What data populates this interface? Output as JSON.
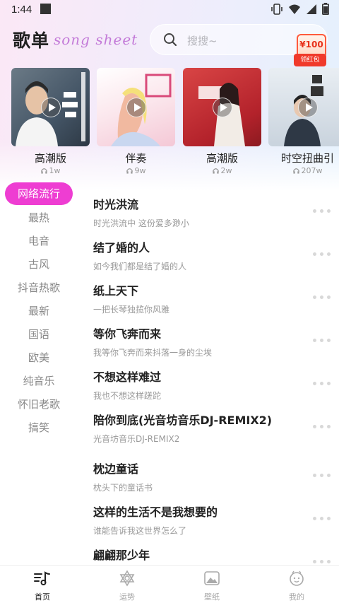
{
  "status_bar": {
    "time": "1:44"
  },
  "header": {
    "title": "歌单",
    "subtitle": "song sheet",
    "search_placeholder": "搜搜~",
    "red_packet": {
      "amount": "¥100",
      "label": "领红包"
    }
  },
  "featured": [
    {
      "name": "高潮版",
      "plays": "1w"
    },
    {
      "name": "伴奏",
      "plays": "9w"
    },
    {
      "name": "高潮版",
      "plays": "2w"
    },
    {
      "name": "时空扭曲引",
      "plays": "207w"
    }
  ],
  "categories": [
    {
      "label": "网络流行",
      "active": true
    },
    {
      "label": "最热"
    },
    {
      "label": "电音"
    },
    {
      "label": "古风"
    },
    {
      "label": "抖音热歌"
    },
    {
      "label": "最新"
    },
    {
      "label": "国语"
    },
    {
      "label": "欧美"
    },
    {
      "label": "纯音乐"
    },
    {
      "label": "怀旧老歌"
    },
    {
      "label": "搞笑"
    }
  ],
  "songs": [
    {
      "title": "时光洪流",
      "subtitle": "时光洪流中 这份爱多渺小"
    },
    {
      "title": "结了婚的人",
      "subtitle": "如今我们都是结了婚的人"
    },
    {
      "title": "纸上天下",
      "subtitle": "一把长琴独揽你风雅"
    },
    {
      "title": "等你飞奔而来",
      "subtitle": "我等你飞奔而来抖落一身的尘埃"
    },
    {
      "title": "不想这样难过",
      "subtitle": "我也不想这样蹉跎"
    },
    {
      "title": "陪你到底(光音坊音乐DJ-REMIX2)",
      "subtitle": "光音坊音乐DJ-REMIX2"
    },
    {
      "title": "枕边童话",
      "subtitle": "枕头下的童话书"
    },
    {
      "title": "这样的生活不是我想要的",
      "subtitle": "谁能告诉我这世界怎么了"
    },
    {
      "title": "翩翩那少年",
      "subtitle": ""
    }
  ],
  "nav": [
    {
      "label": "首页",
      "icon": "music-note-icon",
      "active": true
    },
    {
      "label": "运势",
      "icon": "star-of-david-icon"
    },
    {
      "label": "壁纸",
      "icon": "mountain-image-icon"
    },
    {
      "label": "我的",
      "icon": "smiley-face-icon"
    }
  ],
  "colors": {
    "accent": "#ee3dd2",
    "subtitle": "#c37ad8",
    "red_packet": "#f03a2b"
  }
}
